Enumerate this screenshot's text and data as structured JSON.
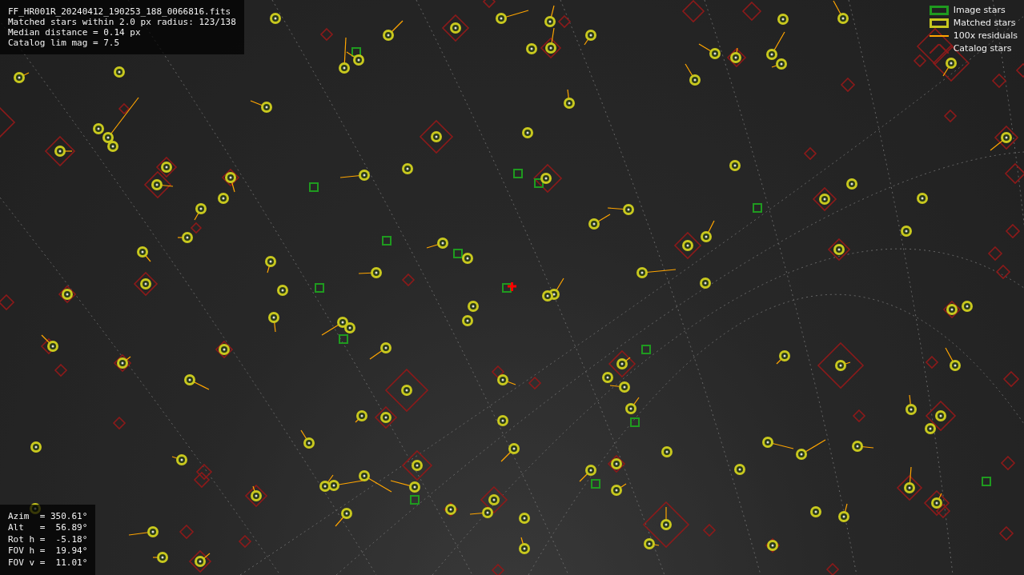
{
  "info_panel": {
    "lines": [
      "FF_HR001R_20240412_190253_188_0066816.fits",
      "Matched stars within 2.0 px radius: 123/138",
      "Median distance = 0.14 px",
      "Catalog lim mag = 7.5"
    ]
  },
  "legend": {
    "items": [
      {
        "label": "Image stars",
        "kind": "box",
        "color": "#1f9a1f"
      },
      {
        "label": "Matched stars",
        "kind": "box",
        "color": "#c8c81e"
      },
      {
        "label": "100x residuals",
        "kind": "line",
        "color": "#ffa500"
      },
      {
        "label": "Catalog stars",
        "kind": "diamond",
        "color": "#8b1a1a"
      }
    ]
  },
  "pointing_panel": {
    "lines": [
      "Azim  = 350.61°",
      "Alt   =  56.89°",
      "Rot h =  -5.18°",
      "FOV h =  19.94°",
      "FOV v =  11.01°"
    ]
  }
}
